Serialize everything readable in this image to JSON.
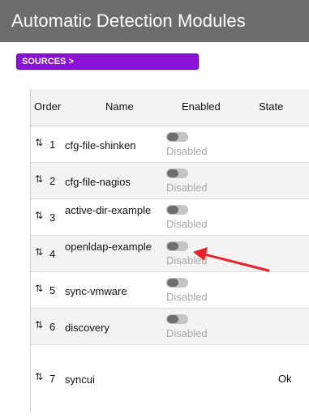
{
  "page": {
    "title": "Automatic Detection Modules"
  },
  "sources_button": {
    "label": "SOURCES >"
  },
  "table": {
    "headers": {
      "order": "Order",
      "name": "Name",
      "enabled": "Enabled",
      "state": "State"
    },
    "rows": [
      {
        "order": "1",
        "name": "cfg-file-shinken",
        "enabled_text": "Disabled",
        "state": ""
      },
      {
        "order": "2",
        "name": "cfg-file-nagios",
        "enabled_text": "Disabled",
        "state": ""
      },
      {
        "order": "3",
        "name": "active-dir-example",
        "enabled_text": "Disabled",
        "state": ""
      },
      {
        "order": "4",
        "name": "openldap-example",
        "enabled_text": "Disabled",
        "state": ""
      },
      {
        "order": "5",
        "name": "sync-vmware",
        "enabled_text": "Disabled",
        "state": ""
      },
      {
        "order": "6",
        "name": "discovery",
        "enabled_text": "Disabled",
        "state": ""
      },
      {
        "order": "7",
        "name": "syncui",
        "enabled_text": "",
        "state": "Ok"
      }
    ]
  },
  "icons": {
    "drag_handle": "drag-handle-icon",
    "toggle": "toggle-switch",
    "annotation": "red-arrow-icon"
  },
  "colors": {
    "title_bar": "#6d6d6d",
    "sources_button": "#8a12d4",
    "annotation_arrow": "#e8202a",
    "disabled_text": "#a8a8a8"
  }
}
